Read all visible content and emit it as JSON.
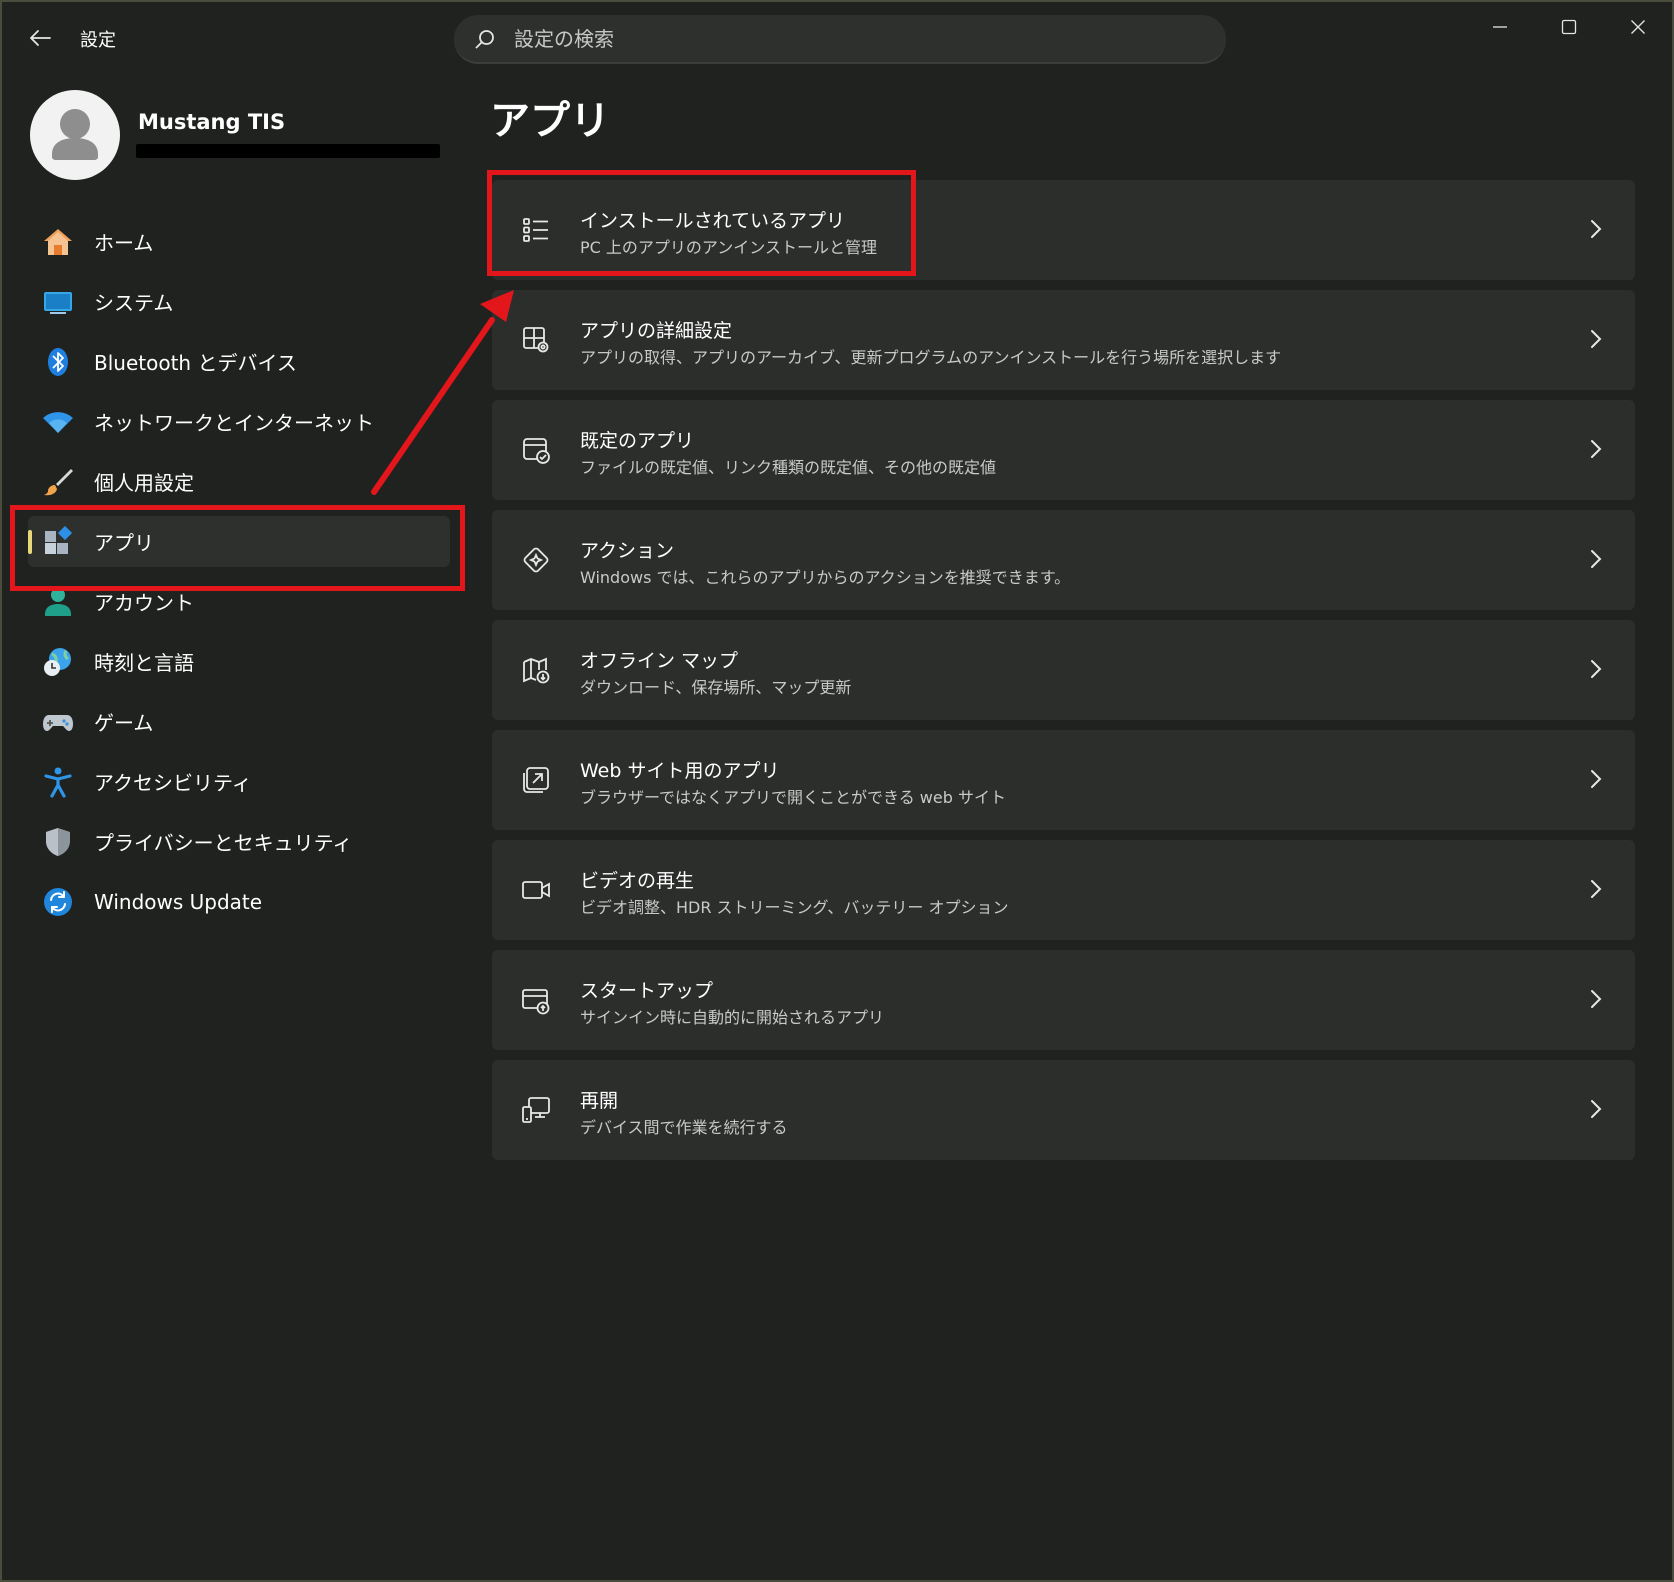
{
  "window": {
    "title": "設定",
    "search_placeholder": "設定の検索"
  },
  "profile": {
    "name": "Mustang TIS"
  },
  "nav": {
    "items": [
      {
        "label": "ホーム",
        "icon": "home-icon"
      },
      {
        "label": "システム",
        "icon": "system-icon"
      },
      {
        "label": "Bluetooth とデバイス",
        "icon": "bluetooth-icon"
      },
      {
        "label": "ネットワークとインターネット",
        "icon": "wifi-icon"
      },
      {
        "label": "個人用設定",
        "icon": "brush-icon"
      },
      {
        "label": "アプリ",
        "icon": "apps-icon",
        "active": true
      },
      {
        "label": "アカウント",
        "icon": "account-icon"
      },
      {
        "label": "時刻と言語",
        "icon": "time-language-icon"
      },
      {
        "label": "ゲーム",
        "icon": "gamepad-icon"
      },
      {
        "label": "アクセシビリティ",
        "icon": "accessibility-icon"
      },
      {
        "label": "プライバシーとセキュリティ",
        "icon": "shield-icon"
      },
      {
        "label": "Windows Update",
        "icon": "update-icon"
      }
    ]
  },
  "main": {
    "title": "アプリ",
    "cards": [
      {
        "title": "インストールされているアプリ",
        "subtitle": "PC 上のアプリのアンインストールと管理",
        "icon": "list-icon"
      },
      {
        "title": "アプリの詳細設定",
        "subtitle": "アプリの取得、アプリのアーカイブ、更新プログラムのアンインストールを行う場所を選択します",
        "icon": "app-settings-icon"
      },
      {
        "title": "既定のアプリ",
        "subtitle": "ファイルの既定値、リンク種類の既定値、その他の既定値",
        "icon": "default-apps-icon"
      },
      {
        "title": "アクション",
        "subtitle": "Windows では、これらのアプリからのアクションを推奨できます。",
        "icon": "actions-icon"
      },
      {
        "title": "オフライン マップ",
        "subtitle": "ダウンロード、保存場所、マップ更新",
        "icon": "map-icon"
      },
      {
        "title": "Web サイト用のアプリ",
        "subtitle": "ブラウザーではなくアプリで開くことができる web サイト",
        "icon": "web-app-icon"
      },
      {
        "title": "ビデオの再生",
        "subtitle": "ビデオ調整、HDR ストリーミング、バッテリー オプション",
        "icon": "video-icon"
      },
      {
        "title": "スタートアップ",
        "subtitle": "サインイン時に自動的に開始されるアプリ",
        "icon": "startup-icon"
      },
      {
        "title": "再開",
        "subtitle": "デバイス間で作業を続行する",
        "icon": "resume-icon"
      }
    ]
  },
  "colors": {
    "accent": "#e8d87a",
    "highlight": "#e3161c"
  }
}
